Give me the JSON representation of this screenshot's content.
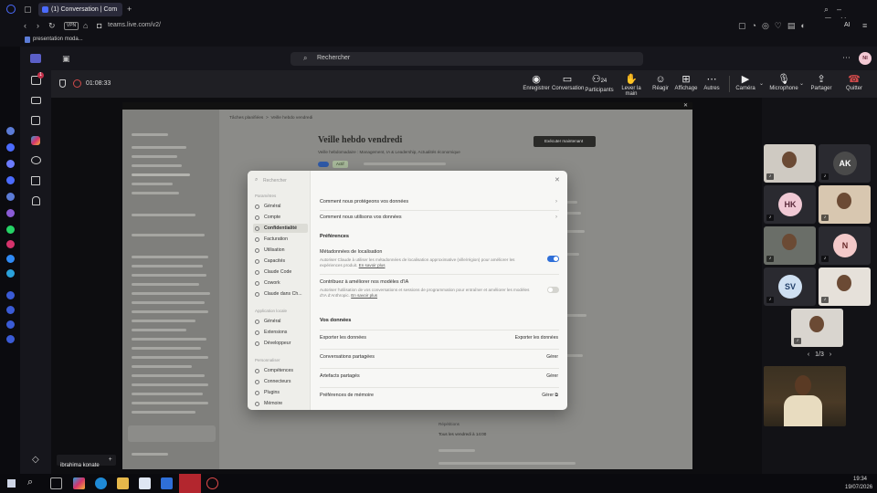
{
  "browser": {
    "tab_title": "(1) Conversation | Com",
    "url": "teams.live.com/v2/",
    "vpn_badge": "VPN",
    "bookmark": "presentation moda...",
    "ai_label": "AI"
  },
  "teams": {
    "search_placeholder": "Rechercher",
    "avatar_initials": "NI",
    "activity_badge": "1",
    "timer": "01:08:33",
    "toolbar": [
      {
        "label": "Enregistrer",
        "icon": "record-icon"
      },
      {
        "label": "Conversation",
        "icon": "chat-icon"
      },
      {
        "label": "Participants",
        "icon": "participants-icon",
        "count": "24"
      },
      {
        "label": "Lever la main",
        "icon": "raise-hand-icon"
      },
      {
        "label": "Réagir",
        "icon": "react-icon"
      },
      {
        "label": "Affichage",
        "icon": "view-icon"
      },
      {
        "label": "Autres",
        "icon": "more-icon"
      }
    ],
    "camera_label": "Caméra",
    "mic_label": "Microphone",
    "share_label": "Partager",
    "quit_label": "Quitter",
    "presenter_name": "ibrahima konate",
    "pager": "1/3"
  },
  "shared": {
    "breadcrumb": "Tâches planifiées  >  Veille hebdo vendredi",
    "task_title": "Veille hebdo vendredi",
    "task_subtitle": "Veille hebdomadaire : Management, IA & Leadership, Actualités économique",
    "run_button": "Exécuter maintenant",
    "active_badge": "Actif",
    "footer_label": "Répétitions",
    "footer_value": "Tous les vendredi à 14:00"
  },
  "modal": {
    "search_placeholder": "Rechercher",
    "nav_section_params": "Paramètres",
    "nav_params": [
      "Général",
      "Compte",
      "Confidentialité",
      "Facturation",
      "Utilisation",
      "Capacités",
      "Claude Code",
      "Cowork",
      "Claude dans Ch..."
    ],
    "nav_section_app": "Application locale",
    "nav_app": [
      "Général",
      "Extensions",
      "Développeur"
    ],
    "nav_section_perso": "Personnaliser",
    "nav_perso": [
      "Compétences",
      "Connecteurs",
      "Plugins",
      "Mémoire"
    ],
    "link_protect": "Comment nous protégeons vos données",
    "link_use": "Comment nous utilisons vos données",
    "prefs_heading": "Préférences",
    "location_title": "Métadonnées de localisation",
    "location_desc": "Autoriser Claude à utiliser les métadonnées de localisation approximative (ville/région) pour améliorer les expériences produit.",
    "learn_more": "En savoir plus",
    "improve_title": "Contribuez à améliorer nos modèles d'IA",
    "improve_desc": "Autoriser l'utilisation de vos conversations et sessions de programmation pour entraîner et améliorer les modèles d'IA d'Anthropic.",
    "data_heading": "Vos données",
    "rows": [
      {
        "label": "Exporter les données",
        "action": "Exporter les données"
      },
      {
        "label": "Conversations partagées",
        "action": "Gérer"
      },
      {
        "label": "Artefacts partagés",
        "action": "Gérer"
      },
      {
        "label": "Préférences de mémoire",
        "action": "Gérer"
      }
    ],
    "colors": {
      "toggle_on": "#2f6fd8",
      "toggle_off": "#d4d4cf"
    }
  },
  "participants": [
    {
      "initials": "",
      "type": "video"
    },
    {
      "initials": "AK",
      "type": "avatar",
      "color": "#4a4a4a",
      "text": "#fff"
    },
    {
      "initials": "HK",
      "type": "avatar",
      "color": "#f0c9d4",
      "text": "#5a2a3a"
    },
    {
      "initials": "",
      "type": "video"
    },
    {
      "initials": "",
      "type": "video"
    },
    {
      "initials": "N",
      "type": "avatar",
      "color": "#f3c9c9",
      "text": "#6a2a2a"
    },
    {
      "initials": "SV",
      "type": "avatar",
      "color": "#cfe0f2",
      "text": "#23406a"
    },
    {
      "initials": "",
      "type": "video"
    },
    {
      "initials": "",
      "type": "video"
    }
  ],
  "taskbar": {
    "time": "19:34",
    "date": "19/07/2026"
  }
}
